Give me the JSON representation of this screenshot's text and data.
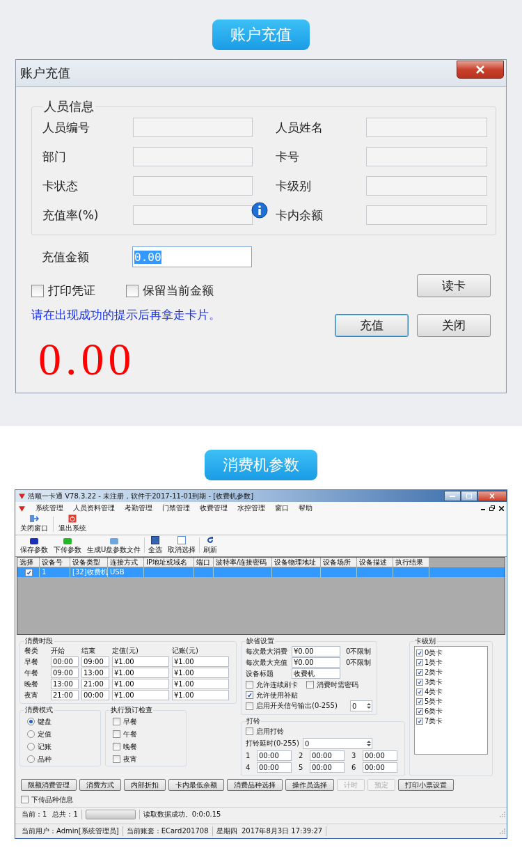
{
  "recharge_section": {
    "badge": "账户充值"
  },
  "recharge_dialog": {
    "title": "账户充值",
    "group_title": "人员信息",
    "fields": [
      {
        "label": "人员编号",
        "kind": "plain"
      },
      {
        "label": "人员姓名",
        "kind": "plain"
      },
      {
        "label": "部门",
        "kind": "plain"
      },
      {
        "label": "卡号",
        "kind": "plain"
      },
      {
        "label": "卡状态",
        "kind": "plain"
      },
      {
        "label": "卡级别",
        "kind": "plain"
      },
      {
        "label": "充值率(%)",
        "kind": "info"
      },
      {
        "label": "卡内余额",
        "kind": "plain"
      }
    ],
    "amount": {
      "label": "充值金额",
      "value": "0.00"
    },
    "checkboxes": [
      {
        "label": "打印凭证",
        "checked": false
      },
      {
        "label": "保留当前金额",
        "checked": false
      }
    ],
    "hint": "请在出现成功的提示后再拿走卡片。",
    "buttons": [
      {
        "label": "读卡",
        "default": false
      },
      {
        "label": "充值",
        "default": true
      },
      {
        "label": "关闭",
        "default": false
      }
    ],
    "balance": "0.00"
  },
  "params_section": {
    "badge": "消费机参数"
  },
  "params_window": {
    "title": "浩顺一卡通 V78.3.22 - 未注册，软件于2017-11-01到期 - [收费机参数]",
    "menu": [
      "系统管理",
      "人员资料管理",
      "考勤管理",
      "门禁管理",
      "收费管理",
      "水控管理",
      "窗口",
      "帮助"
    ],
    "toolbar": [
      {
        "label": "关闭窗口",
        "kind": "exit"
      },
      {
        "label": "退出系统",
        "kind": "power"
      }
    ],
    "param_toolbar": [
      {
        "label": "保存参数",
        "kind": "blue"
      },
      {
        "label": "下传参数",
        "kind": "green"
      },
      {
        "label": "生成U盘参数文件",
        "kind": "light"
      },
      {
        "label": "全选",
        "kind": "all"
      },
      {
        "label": "取消选择",
        "kind": "none"
      },
      {
        "label": "刷新",
        "kind": "refresh"
      }
    ],
    "table": {
      "columns": [
        "选择",
        "设备号",
        "设备类型",
        "连接方式",
        "IP地址或域名",
        "端口",
        "波特率/连接密码",
        "设备物理地址",
        "设备场所",
        "设备描述",
        "执行结果"
      ],
      "rows": [
        {
          "selected": true,
          "checked": true,
          "cells": [
            "",
            "1",
            "[32]收费机",
            "USB"
          ]
        }
      ]
    },
    "periods": {
      "title": "消费时段",
      "headers": [
        "餐类",
        "开始",
        "结束",
        "定值(元)",
        "记账(元)"
      ],
      "rows": [
        {
          "name": "早餐",
          "values": [
            "00:00",
            "09:00",
            "¥1.00",
            "¥1.00"
          ]
        },
        {
          "name": "午餐",
          "values": [
            "09:00",
            "13:00",
            "¥1.00",
            "¥1.00"
          ]
        },
        {
          "name": "晚餐",
          "values": [
            "13:00",
            "21:00",
            "¥1.00",
            "¥1.00"
          ]
        },
        {
          "name": "夜宵",
          "values": [
            "21:00",
            "00:00",
            "¥1.00",
            "¥1.00"
          ]
        }
      ]
    },
    "defaults": {
      "title": "缺省设置",
      "rows": [
        {
          "label": "每次最大消费",
          "value": "¥0.00",
          "note": "0不限制"
        },
        {
          "label": "每次最大充值",
          "value": "¥0.00",
          "note": "0不限制"
        },
        {
          "label": "设备标题",
          "value": "收费机"
        }
      ],
      "checks": [
        {
          "label": "允许连续刷卡",
          "checked": false
        },
        {
          "label": "消费时需密码",
          "checked": false
        },
        {
          "label": "允许使用补贴",
          "checked": true
        },
        {
          "label": "启用开关信号输出(0-255)",
          "checked": false
        }
      ],
      "signal_value": "0"
    },
    "card_levels": {
      "title": "卡级别",
      "items": [
        {
          "label": "0类卡",
          "checked": true
        },
        {
          "label": "1类卡",
          "checked": true
        },
        {
          "label": "2类卡",
          "checked": true
        },
        {
          "label": "3类卡",
          "checked": true
        },
        {
          "label": "4类卡",
          "checked": true
        },
        {
          "label": "5类卡",
          "checked": true
        },
        {
          "label": "6类卡",
          "checked": true
        },
        {
          "label": "7类卡",
          "checked": true
        }
      ]
    },
    "mode": {
      "title": "消费模式",
      "options": [
        {
          "label": "键盘",
          "selected": true
        },
        {
          "label": "定值",
          "selected": false
        },
        {
          "label": "记账",
          "selected": false
        },
        {
          "label": "品种",
          "selected": false
        }
      ]
    },
    "booking": {
      "title": "执行预订检查",
      "options": [
        {
          "label": "早餐",
          "checked": false
        },
        {
          "label": "午餐",
          "checked": false
        },
        {
          "label": "晚餐",
          "checked": false
        },
        {
          "label": "夜宵",
          "checked": false
        }
      ]
    },
    "bell": {
      "title": "打铃",
      "enable": {
        "label": "启用打铃",
        "checked": false
      },
      "delay_label": "打铃延时(0-255)",
      "delay_value": "0",
      "times": [
        {
          "index": "1",
          "value": "00:00"
        },
        {
          "index": "2",
          "value": "00:00"
        },
        {
          "index": "3",
          "value": "00:00"
        },
        {
          "index": "4",
          "value": "00:00"
        },
        {
          "index": "5",
          "value": "00:00"
        },
        {
          "index": "6",
          "value": "00:00"
        }
      ]
    },
    "buttons": [
      {
        "label": "限额消费管理",
        "disabled": false
      },
      {
        "label": "消费方式",
        "disabled": false
      },
      {
        "label": "内部折扣",
        "disabled": false
      },
      {
        "label": "卡内最低余额",
        "disabled": false
      },
      {
        "label": "消费品种选择",
        "disabled": false
      },
      {
        "label": "操作员选择",
        "disabled": false
      },
      {
        "label": "计时",
        "disabled": true
      },
      {
        "label": "预定",
        "disabled": true
      },
      {
        "label": "打印小票设置",
        "disabled": false
      }
    ],
    "send_items": {
      "label": "下传品种信息",
      "checked": false
    },
    "status": {
      "current": "当前：1",
      "total": "总共：1",
      "progress": {
        "level": 0
      },
      "message": "读取数据成功。0:0:0.15"
    },
    "status_bar": [
      "当前用户：Admin[系统管理员]",
      "当前账套：ECard201708",
      "星期四  2017年8月3日 17:39:27"
    ]
  }
}
